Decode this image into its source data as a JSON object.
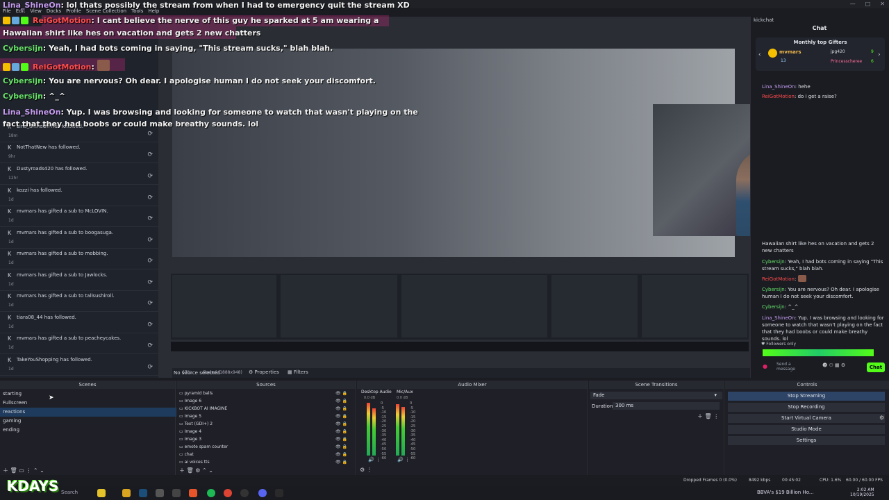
{
  "window": {
    "menu": [
      "File",
      "Edit",
      "View",
      "Docks",
      "Profile",
      "Scene Collection",
      "Tools",
      "Help"
    ],
    "controls": [
      "—",
      "□",
      "✕"
    ]
  },
  "chat_overlay": {
    "lines": [
      {
        "user": "Lina_ShineOn",
        "text": "lol thats possibly the stream from when I had to emergency quit the stream XD"
      },
      {
        "user": "ReiGotMotion",
        "text": "I cant believe the nerve of this guy he sparked at 5 am wearing a"
      },
      {
        "user": "",
        "text": "Hawaiian shirt like hes on vacation and gets 2 new chatters"
      },
      {
        "user": "Cybersijn",
        "text": "Yeah, I had bots coming in saying, \"This stream sucks,\" blah blah."
      },
      {
        "user": "ReiGotMotion",
        "text": ""
      },
      {
        "user": "Cybersijn",
        "text": "You are nervous? Oh dear. I apologise human I do not seek your discomfort."
      },
      {
        "user": "Cybersijn",
        "text": "^_^"
      },
      {
        "user": "Lina_ShineOn",
        "text": "Yup. I was browsing and looking for someone to watch that wasn't playing on the"
      },
      {
        "user": "",
        "text": "fact that they had boobs or could make breathy sounds. lol"
      }
    ]
  },
  "followers": [
    {
      "text": "Lina_ShineOn has followed.",
      "age": "18m"
    },
    {
      "text": "NotThatNew has followed.",
      "age": "9hr"
    },
    {
      "text": "Dustyroads420 has followed.",
      "age": "12hr"
    },
    {
      "text": "kozzi has followed.",
      "age": "1d"
    },
    {
      "text": "mvmars has gifted a sub to McLOVIN.",
      "age": "1d"
    },
    {
      "text": "mvmars has gifted a sub to boogasuga.",
      "age": "1d"
    },
    {
      "text": "mvmars has gifted a sub to mobbing.",
      "age": "1d"
    },
    {
      "text": "mvmars has gifted a sub to Jawlocks.",
      "age": "1d"
    },
    {
      "text": "mvmars has gifted a sub to tallsushiroll.",
      "age": "1d"
    },
    {
      "text": "tiara08_44 has followed.",
      "age": "1d"
    },
    {
      "text": "mvmars has gifted a sub to peacheycakes.",
      "age": "1d"
    },
    {
      "text": "TakeYouShopping has followed.",
      "age": "1d"
    }
  ],
  "kickchat": {
    "dock_title": "kickchat",
    "header": "Chat",
    "gifters_title": "Monthly top Gifters",
    "gifters": [
      {
        "name": "mvmars",
        "count": "13"
      },
      {
        "name": "jpg420",
        "count": "9"
      },
      {
        "name": "Princesscheree",
        "count": "6"
      }
    ],
    "messages": [
      {
        "user": "Lina_ShineOn",
        "text": "hehe"
      },
      {
        "user": "ReiGotMotion",
        "text": "do i get a raise?"
      },
      {
        "user": "",
        "text": "Hawaiian shirt like hes on vacation and gets 2 new chatters"
      },
      {
        "user": "Cybersijn",
        "text": "Yeah, I had bots coming in saying \"This stream sucks,\" blah blah."
      },
      {
        "user": "ReiGotMotion",
        "text": ""
      },
      {
        "user": "Cybersijn",
        "text": "You are nervous? Oh dear. I apologise human I do not seek your discomfort."
      },
      {
        "user": "Cybersijn",
        "text": "^_^"
      },
      {
        "user": "Lina_ShineOn",
        "text": "Yup. I was browsing and looking for someone to watch that wasn't playing on the fact that they had boobs or could make breathy sounds. lol"
      }
    ],
    "followers_only": "Followers only",
    "input_placeholder": "Send a message",
    "send_label": "Chat"
  },
  "capture_bar": {
    "zoom": "67%",
    "scaled": "Scaled (1888x948)",
    "no_source": "No source selected",
    "properties": "Properties",
    "filters": "Filters"
  },
  "docks": {
    "scenes": {
      "title": "Scenes",
      "items": [
        "starting",
        "Fullscreen",
        "reactions",
        "gaming",
        "ending"
      ],
      "selected": "reactions"
    },
    "sources": {
      "title": "Sources",
      "items": [
        "pyramid balls",
        "Image 6",
        "KICKBOT AI IMAGINE",
        "Image 5",
        "Text (GDI+) 2",
        "Image 4",
        "Image 3",
        "emote spam counter",
        "chat",
        "ai voices tts"
      ]
    },
    "audio": {
      "title": "Audio Mixer",
      "channels": [
        {
          "name": "Desktop Audio",
          "level": "0.0 dB"
        },
        {
          "name": "Mic/Aux",
          "level": "0.0 dB"
        }
      ],
      "ticks": [
        "0",
        "-5",
        "-10",
        "-15",
        "-20",
        "-25",
        "-30",
        "-35",
        "-40",
        "-45",
        "-50",
        "-55",
        "-60"
      ]
    },
    "transitions": {
      "title": "Scene Transitions",
      "type": "Fade",
      "duration_label": "Duration",
      "duration_value": "300 ms"
    },
    "controls": {
      "title": "Controls",
      "buttons": [
        "Stop Streaming",
        "Stop Recording",
        "Start Virtual Camera",
        "Studio Mode",
        "Settings"
      ]
    }
  },
  "status": {
    "dropped": "Dropped Frames 0 (0.0%)",
    "bitrate": "8492 kbps",
    "time": "00:45:02",
    "cpu": "CPU: 1.6%",
    "fps": "60.00 / 60.00 FPS"
  },
  "taskbar": {
    "search": "Search",
    "news": "BBVA's $19 Billion Ho...",
    "clock": "2:02 AM",
    "date": "10/19/2025"
  },
  "logo": "KDAYS"
}
